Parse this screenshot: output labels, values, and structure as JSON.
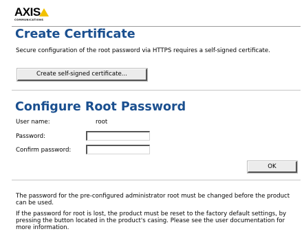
{
  "brand": {
    "logo_text": "AXIS",
    "logo_subtext": "COMMUNICATIONS",
    "logo_color": "#f2c100"
  },
  "colors": {
    "heading": "#1a4f8f"
  },
  "certificate": {
    "title": "Create Certificate",
    "description": "Secure configuration of the root password via HTTPS requires a self-signed certificate.",
    "button_label": "Create self-signed certificate..."
  },
  "root_password": {
    "title": "Configure Root Password",
    "user_name_label": "User name:",
    "user_name_value": "root",
    "password_label": "Password:",
    "password_value": "",
    "confirm_label": "Confirm password:",
    "confirm_value": "",
    "ok_label": "OK"
  },
  "notes": {
    "para1": "The password for the pre-configured administrator root must be changed before the product can be used.",
    "para2": "If the password for root is lost, the product must be reset to the factory default settings, by pressing the button located in the product's casing. Please see the user documentation for more information."
  }
}
